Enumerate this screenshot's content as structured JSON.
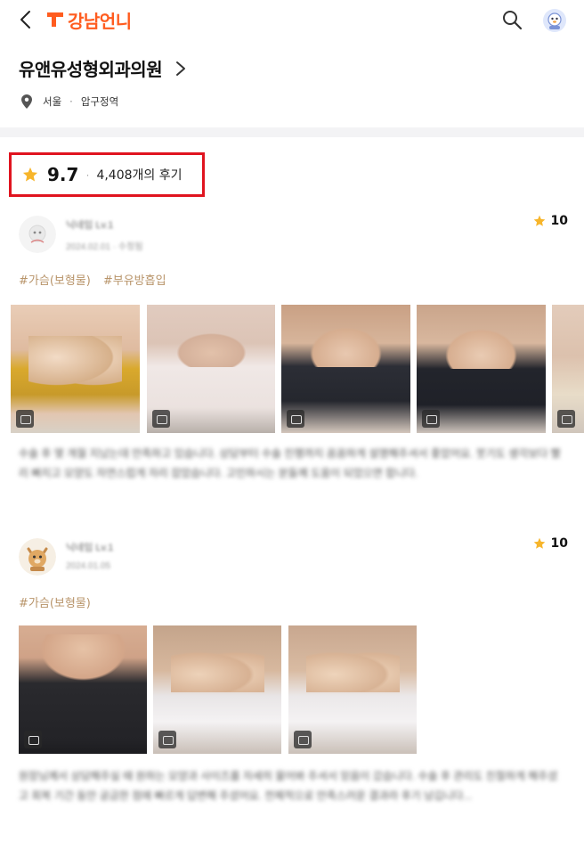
{
  "app": {
    "brand": "강남언니",
    "colors": {
      "brand": "#ff5c1f",
      "tag": "#b8946a",
      "highlight": "#e0141f",
      "star": "#f7b52b"
    }
  },
  "header": {
    "back_icon": "chevron-left-icon",
    "search_icon": "search-icon",
    "profile_icon": "avatar"
  },
  "hospital": {
    "name": "유앤유성형외과의원",
    "city": "서울",
    "station": "압구정역"
  },
  "rating": {
    "score": "9.7",
    "review_count": "4,408개의 후기"
  },
  "reviews": [
    {
      "user": "닉네임 Lv.1",
      "date": "2024.02.01 · 수정됨",
      "score": "10",
      "tags": [
        "#가슴(보형물)",
        "#부유방흡입"
      ],
      "text": "수술 후 몇 개월 지났는데 만족하고 있습니다. 상담부터 수술 진행까지 꼼꼼하게 설명해주셔서 좋았어요. 붓기도 생각보다 빨리 빠지고 모양도 자연스럽게 자리 잡았습니다. 고민하시는 분들께 도움이 되었으면 합니다."
    },
    {
      "user": "닉네임 Lv.1",
      "date": "2024.01.05",
      "score": "10",
      "tags": [
        "#가슴(보형물)"
      ],
      "text": "원장님께서 상담해주실 때 원하는 모양과 사이즈를 자세히 물어봐 주셔서 믿음이 갔습니다. 수술 후 관리도 친절하게 해주셨고 회복 기간 동안 궁금한 점에 빠르게 답변해 주셨어요. 전체적으로 만족스러운 결과라 후기 남깁니다..."
    }
  ]
}
